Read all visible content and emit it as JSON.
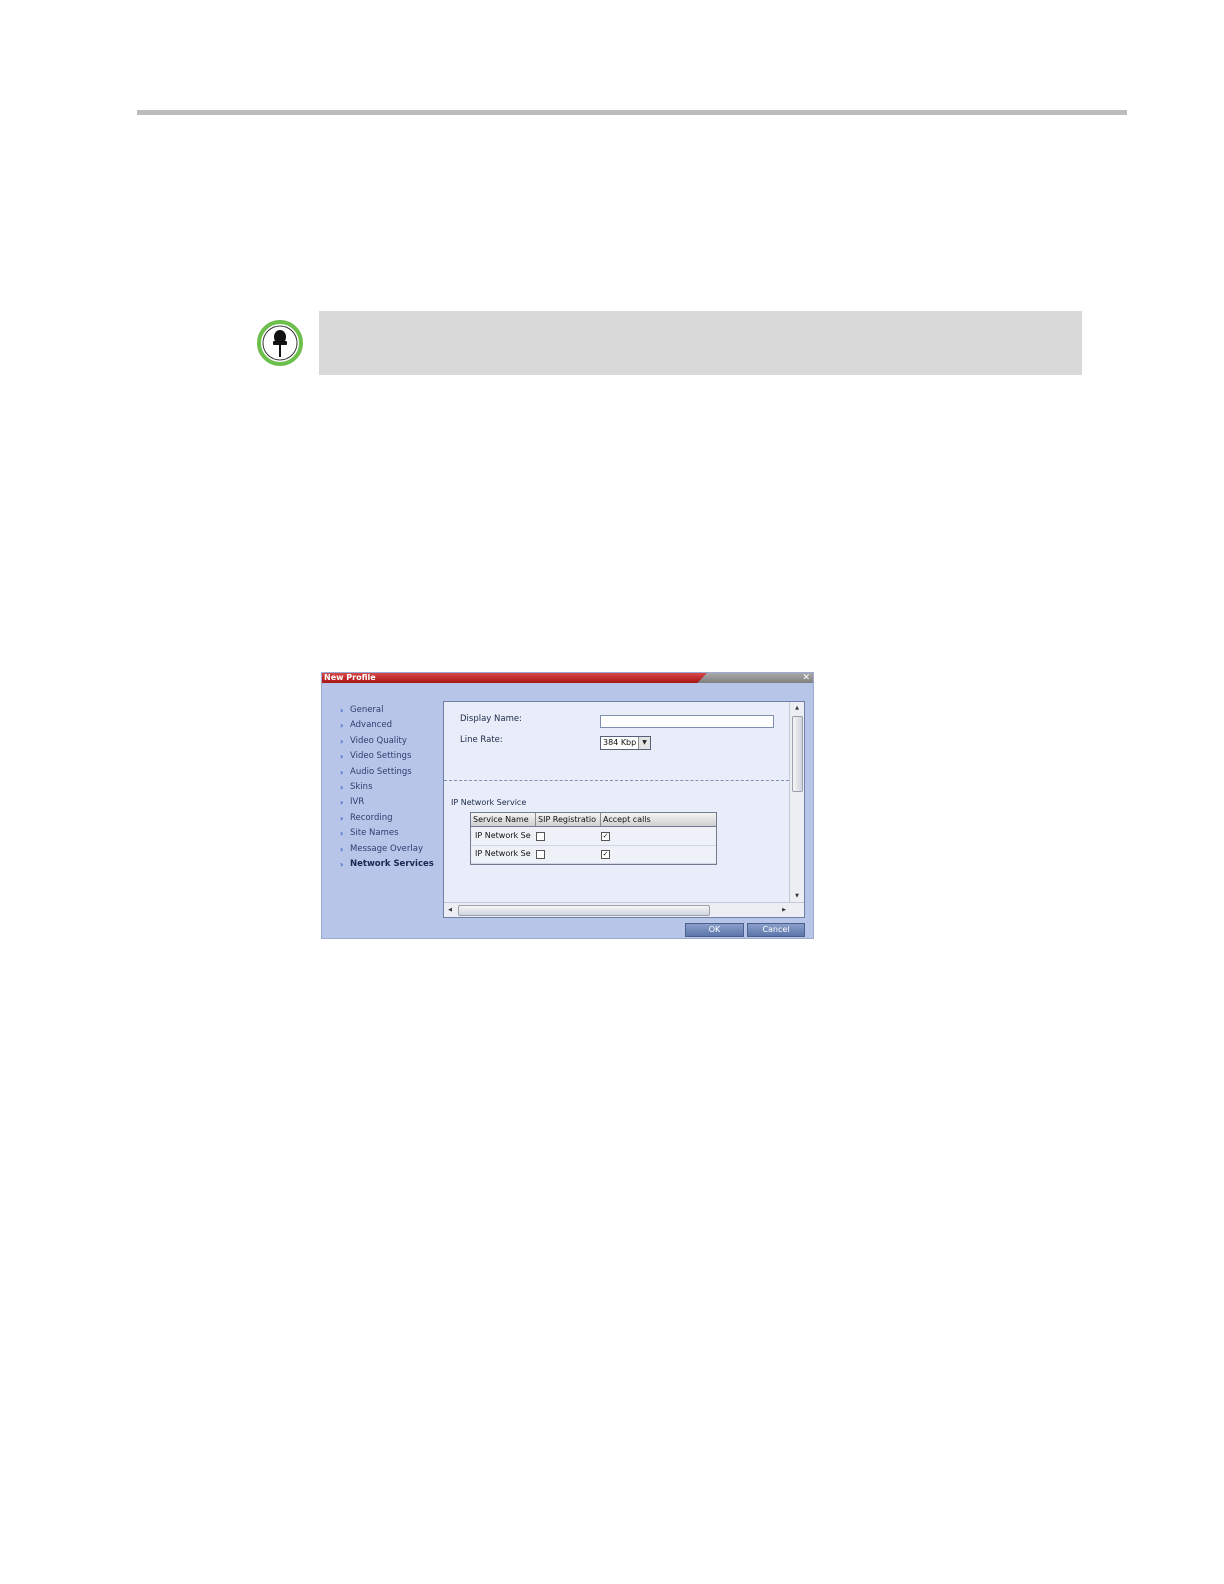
{
  "dialog": {
    "title": "New Profile",
    "nav": [
      {
        "label": "General"
      },
      {
        "label": "Advanced"
      },
      {
        "label": "Video Quality"
      },
      {
        "label": "Video Settings"
      },
      {
        "label": "Audio Settings"
      },
      {
        "label": "Skins"
      },
      {
        "label": "IVR"
      },
      {
        "label": "Recording"
      },
      {
        "label": "Site Names"
      },
      {
        "label": "Message Overlay"
      },
      {
        "label": "Network Services",
        "active": true
      }
    ],
    "display_name_label": "Display Name:",
    "display_name_value": "",
    "line_rate_label": "Line Rate:",
    "line_rate_value": "384 Kbp",
    "group_label": "IP Network Service",
    "table": {
      "headers": [
        "Service Name",
        "SIP Registratio",
        "Accept calls"
      ],
      "rows": [
        {
          "name": "IP Network Se",
          "sip_registration": false,
          "accept_calls": true
        },
        {
          "name": "IP Network Se",
          "sip_registration": false,
          "accept_calls": true
        }
      ]
    },
    "ok_label": "OK",
    "cancel_label": "Cancel"
  },
  "colors": {
    "title_accent": "#b81e1e",
    "dialog_bg": "#b7c6e8",
    "note_box": "#d9d9d9",
    "note_icon_ring": "#6cbf4a"
  }
}
